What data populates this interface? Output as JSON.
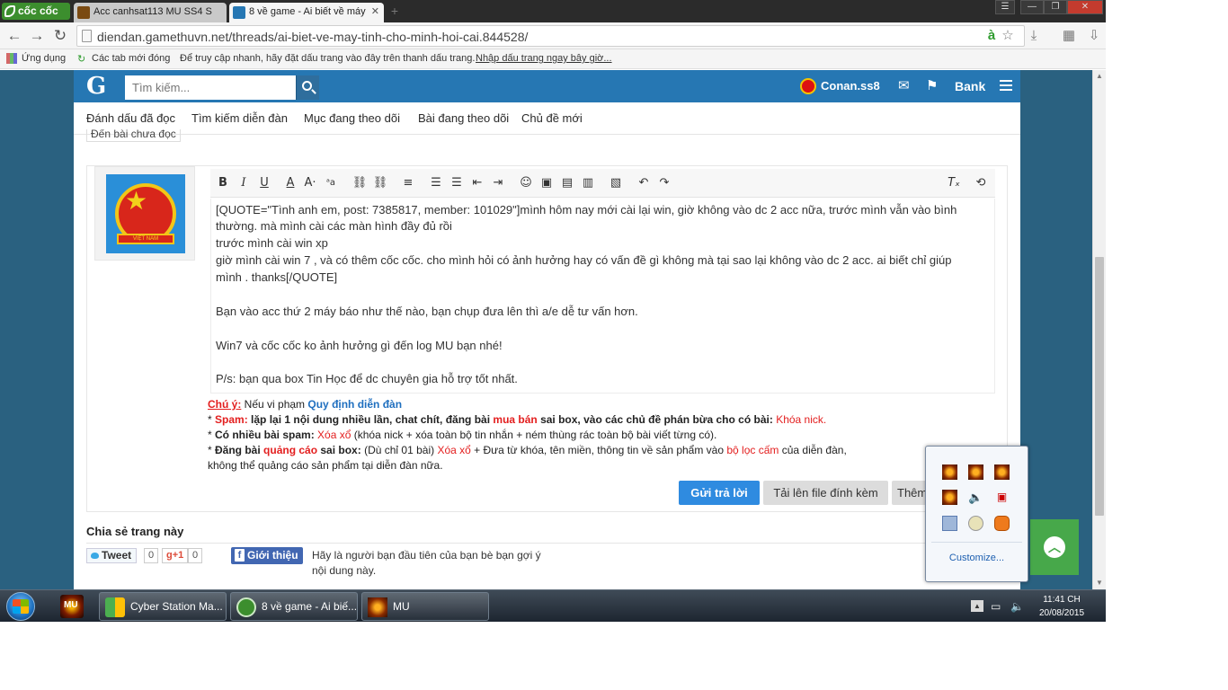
{
  "browser": {
    "logo": "cốc cốc",
    "tabs": [
      {
        "title": "Acc canhsat113 MU SS4 S"
      },
      {
        "title": "8 về game - Ai biết về máy"
      }
    ],
    "url": "diendan.gamethuvn.net/threads/ai-biet-ve-may-tinh-cho-minh-hoi-cai.844528/",
    "bookmarks": {
      "apps": "Ứng dụng",
      "recent_tabs": "Các tab mới đóng",
      "hint": "Để truy cập nhanh, hãy đặt dấu trang vào đây trên thanh dấu trang.",
      "import_link": "Nhập dấu trang ngay bây giờ..."
    }
  },
  "forum": {
    "logo": "G",
    "search_placeholder": "Tìm kiếm...",
    "username": "Conan.ss8",
    "bank": "Bank",
    "nav": [
      "Đánh dấu đã đọc",
      "Tìm kiếm diễn đàn",
      "Mục đang theo dõi",
      "Bài đang theo dõi",
      "Chủ đề mới"
    ],
    "cut_tab": "Đến bài chưa đọc",
    "avatar_ribbon": "VIỆT NAM",
    "editor_lines": [
      "[QUOTE=\"Tình anh em, post: 7385817, member: 101029\"]mình hôm nay mới cài lại win, giờ không vào dc 2 acc nữa, trước mình vẫn vào bình",
      "thường. mà mình cài các màn hình đầy đủ rồi",
      "trước mình cài win xp",
      "giờ mình cài win 7 , và có thêm cốc cốc. cho mình hỏi có ảnh hưởng hay có vấn đề gì không mà tại sao lại không vào dc 2 acc. ai biết chỉ giúp",
      "mình . thanks[/QUOTE]",
      "",
      "Bạn vào acc thứ 2 máy báo như thế nào, bạn chụp đưa lên thì a/e dễ tư vấn hơn.",
      "",
      "Win7 và cốc cốc ko ảnh hưởng gì đến log MU bạn nhé!",
      "",
      "P/s: bạn qua box Tin Học để dc chuyên gia hỗ trợ tốt nhất."
    ],
    "rules": {
      "note_label": "Chú ý:",
      "note_text": " Nếu vi phạm ",
      "note_link": "Quy định diễn đàn",
      "r1_star": "* ",
      "r1_label": "Spam:",
      "r1_text1": " lặp lại 1 nội dung nhiều lần, chat chít, đăng bài ",
      "r1_red": "mua bán",
      "r1_text2": " sai box, vào các chủ đề phán bừa cho có bài: ",
      "r1_penalty": "Khóa nick.",
      "r2_star": "* ",
      "r2_label": "Có nhiều bài spam:",
      "r2_penalty": " Xóa xổ",
      "r2_text": " (khóa nick + xóa toàn bộ tin nhắn + ném thùng rác toàn bộ bài viết từng có).",
      "r3_star": "* ",
      "r3_label1": "Đăng bài ",
      "r3_red": "quảng cáo",
      "r3_label2": " sai box:",
      "r3_text1": " (Dù chỉ 01 bài) ",
      "r3_penalty": "Xóa xổ",
      "r3_text2": " + Đưa từ khóa, tên miền, thông tin về sản phẩm vào ",
      "r3_filter": "bộ lọc cấm",
      "r3_text3": " của diễn đàn,",
      "r3_line2": "không thể quảng cáo sản phẩm tại diễn đàn nữa."
    },
    "buttons": {
      "reply": "Gửi trả lời",
      "upload": "Tải lên file đính kèm",
      "more": "Thêm"
    },
    "share": {
      "title": "Chia sẻ trang này",
      "tweet": "Tweet",
      "tweet_count": "0",
      "gplus": "g+1",
      "gplus_count": "0",
      "fb": "Giới thiệu",
      "fb_text": "Hãy là người bạn đầu tiên của bạn bè bạn gợi ý nội dung này."
    }
  },
  "tray_popup": {
    "customize": "Customize..."
  },
  "taskbar": {
    "items": [
      "Cyber Station Ma...",
      "8 về game - Ai biế...",
      "MU"
    ],
    "pinned": "MU",
    "time": "11:41 CH",
    "date": "20/08/2015"
  },
  "colors": {
    "forum_header": "#2677b3",
    "page_bg": "#2a6180",
    "reply_button": "#2f8be0",
    "warning_red": "#e31e1e",
    "scroll_top": "#47a84a"
  }
}
